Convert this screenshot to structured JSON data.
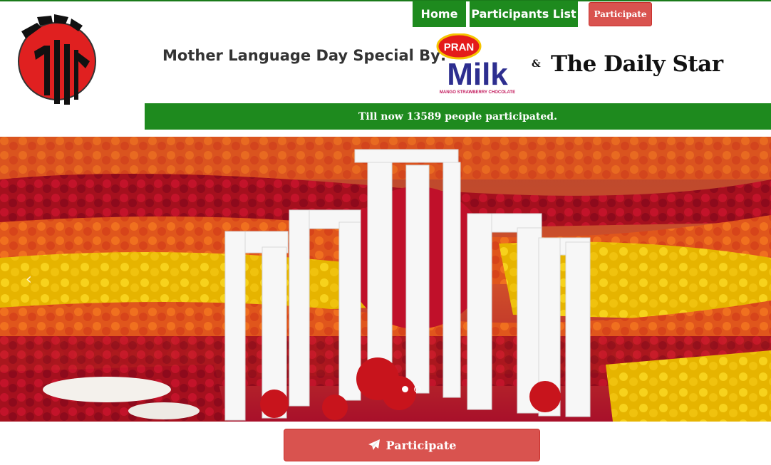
{
  "nav": {
    "home": "Home",
    "participants_list": "Participants List",
    "participate": "Participate"
  },
  "header": {
    "special_by": "Mother Language Day Special By:",
    "sponsor_pran_brand": "PRAN",
    "sponsor_pran_product": "Milk",
    "sponsor_pran_flavors": "MANGO  STRAWBERRY  CHOCOLATE",
    "ampersand": "&",
    "sponsor_star": "The Daily Star"
  },
  "banner": {
    "text": "Till now 13589 people participated."
  },
  "hero": {
    "prev_icon": "‹",
    "slides": 2,
    "active_slide": 1
  },
  "cta": {
    "label": "Participate",
    "icon": "paper-plane-icon"
  },
  "colors": {
    "green": "#1e8a1e",
    "red": "#d9534f"
  }
}
